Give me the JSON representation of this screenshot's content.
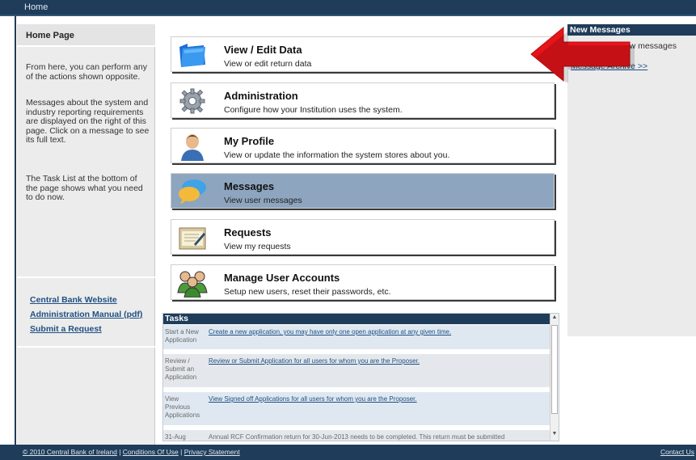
{
  "topbar": {
    "tab": "Home"
  },
  "sidebar": {
    "heading": "Home Page",
    "p1": "From here, you can perform any of the actions shown opposite.",
    "p2": "Messages about the system and industry reporting requirements are displayed on the right of this page. Click on a message to see its full text.",
    "p3": "The Task List at the bottom of the page shows what you need to do now.",
    "links": [
      "Central Bank Website",
      "Administration Manual (pdf)",
      "Submit a Request"
    ]
  },
  "menu": [
    {
      "title": "View / Edit Data",
      "desc": "View or edit return data",
      "icon": "folder-icon"
    },
    {
      "title": "Administration",
      "desc": "Configure how your Institution uses the system.",
      "icon": "gear-icon"
    },
    {
      "title": "My Profile",
      "desc": "View or update the information the system stores about you.",
      "icon": "user-icon"
    },
    {
      "title": "Messages",
      "desc": "View user messages",
      "icon": "chat-bubbles-icon"
    },
    {
      "title": "Requests",
      "desc": "View my requests",
      "icon": "notepad-icon"
    },
    {
      "title": "Manage User Accounts",
      "desc": "Setup new users, reset their passwords, etc.",
      "icon": "users-group-icon"
    }
  ],
  "tasks": {
    "header": "Tasks",
    "rows": [
      {
        "label": "Start a New Application",
        "link": "Create a new application, you may have only one open application at any given time."
      },
      {
        "label": "Review / Submit an Application",
        "link": "Review or Submit Application for all users for whom you are the Proposer."
      },
      {
        "label": "View Previous Applications",
        "link": "View Signed off Applications for all users for whom you are the Proposer."
      },
      {
        "label": "31-Aug",
        "link": "Annual RCF Confirmation return for 30-Jun-2013 needs to be completed. This return must be submitted"
      }
    ]
  },
  "messages": {
    "header": "New Messages",
    "text": "You have no new messages",
    "archive": "Message Archive >>"
  },
  "footer": {
    "copyright": "© 2010 Central Bank of Ireland",
    "sep": " | ",
    "conditions": "Conditions Of Use",
    "privacy": "Privacy Statement",
    "contact": "Contact Us"
  },
  "colors": {
    "navy": "#1f3c5a",
    "active": "#8ea5bf",
    "link": "#1f4f82",
    "arrow": "#e8141a"
  }
}
